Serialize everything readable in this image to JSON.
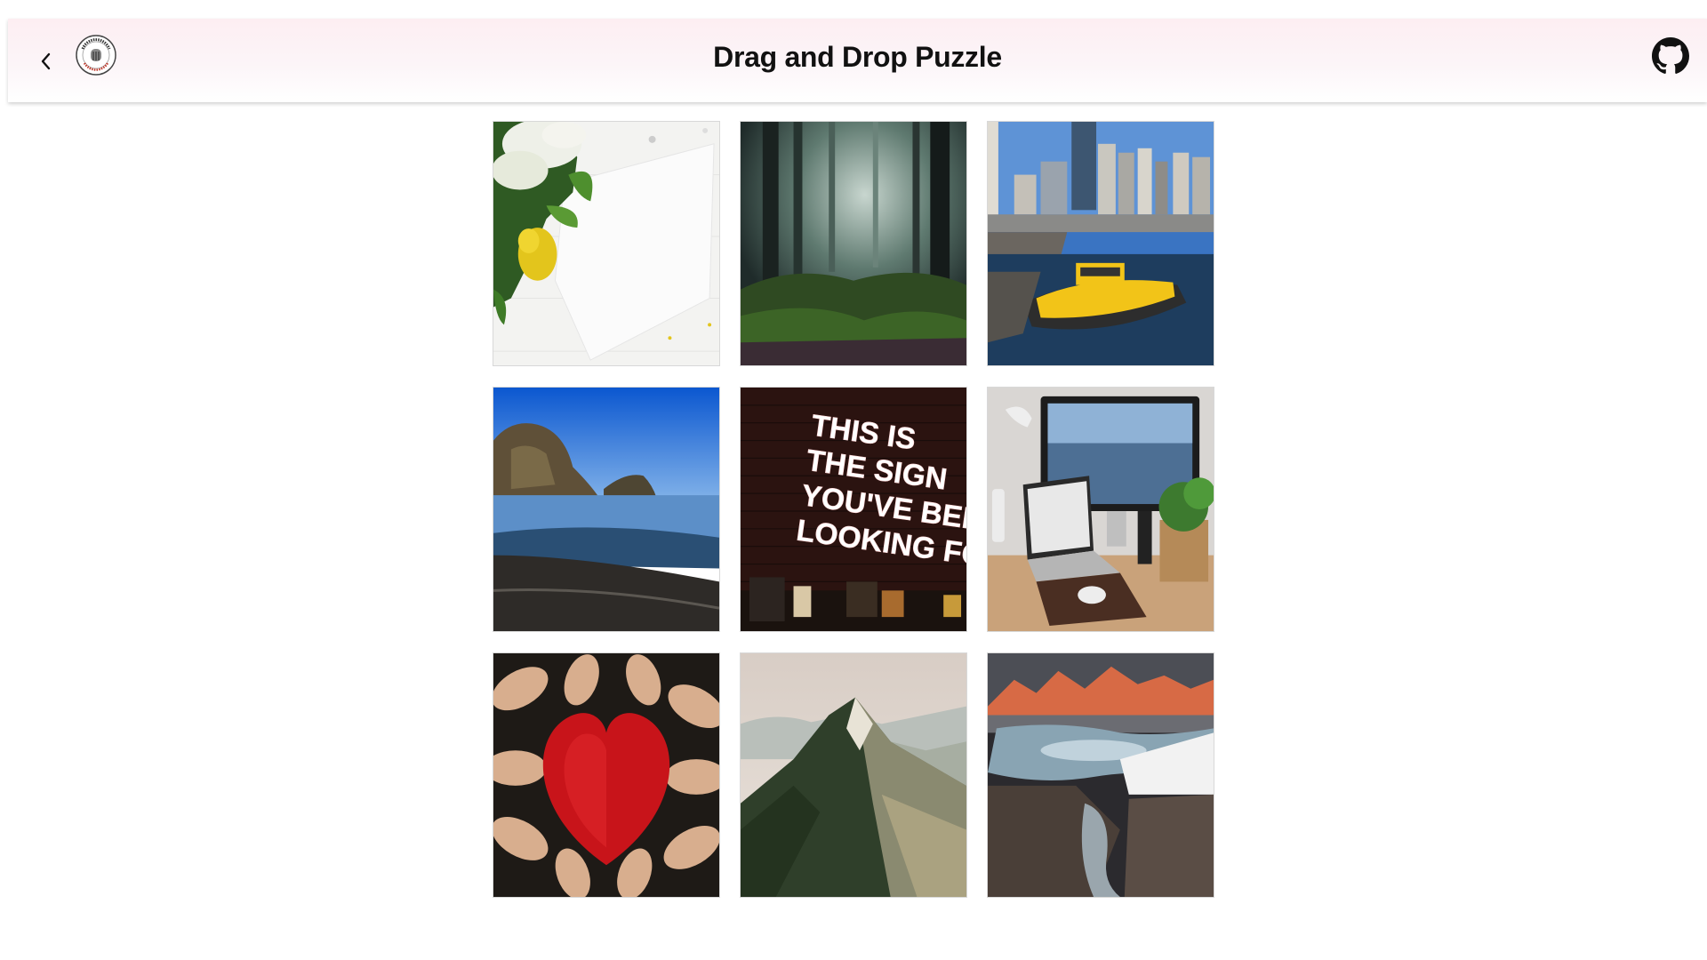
{
  "header": {
    "title": "Drag and Drop Puzzle",
    "back_icon": "chevron-left-icon",
    "logo_icon": "frontend-mini-challenges-logo",
    "github_icon": "github-icon"
  },
  "puzzle": {
    "tiles": [
      {
        "name": "flowers-paper"
      },
      {
        "name": "misty-forest"
      },
      {
        "name": "city-water-taxi"
      },
      {
        "name": "beach-cliffs"
      },
      {
        "name": "neon-sign"
      },
      {
        "name": "desk-computer"
      },
      {
        "name": "painted-hands-heart"
      },
      {
        "name": "mountain-ridge"
      },
      {
        "name": "alpine-lake"
      }
    ],
    "neon_text": [
      "THIS IS",
      "THE SIGN",
      "YOU'VE BEEN",
      "LOOKING FOR"
    ]
  },
  "colors": {
    "header_tint": "#fdeef2",
    "title": "#111111"
  }
}
